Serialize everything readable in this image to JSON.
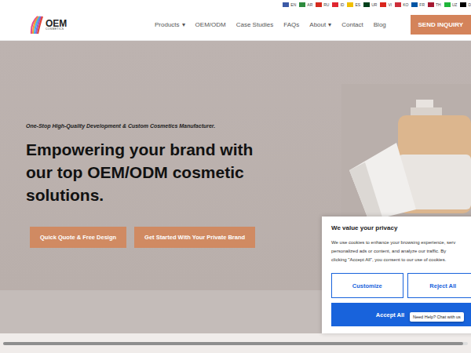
{
  "language_bar": [
    {
      "label": "EN",
      "color": "#3c5aa6"
    },
    {
      "label": "AR",
      "color": "#2e8b3e"
    },
    {
      "label": "RU",
      "color": "#d52b1e"
    },
    {
      "label": "ID",
      "color": "#e0252f"
    },
    {
      "label": "ES",
      "color": "#f1bf00"
    },
    {
      "label": "UR",
      "color": "#01411c"
    },
    {
      "label": "VI",
      "color": "#da251d"
    },
    {
      "label": "KO",
      "color": "#cd2e3a"
    },
    {
      "label": "FR",
      "color": "#0055a4"
    },
    {
      "label": "TH",
      "color": "#a51931"
    },
    {
      "label": "UZ",
      "color": "#1eb53a"
    },
    {
      "label": "D",
      "color": "#000000"
    }
  ],
  "logo": {
    "main": "OEM",
    "sub": "COSMETICS"
  },
  "nav": [
    {
      "label": "Products",
      "caret": "▾"
    },
    {
      "label": "OEM/ODM",
      "caret": ""
    },
    {
      "label": "Case Studies",
      "caret": ""
    },
    {
      "label": "FAQs",
      "caret": ""
    },
    {
      "label": "About",
      "caret": "▾"
    },
    {
      "label": "Contact",
      "caret": ""
    },
    {
      "label": "Blog",
      "caret": ""
    }
  ],
  "inquiry_button": "SEND INQUIRY",
  "hero": {
    "tagline": "One-Stop High-Quality Development & Custom Cosmetics Manufacturer.",
    "headline": "Empowering your brand with our top OEM/ODM cosmetic solutions.",
    "buttons": [
      "Quick Quote & Free Design",
      "Get Started With Your Private Brand"
    ]
  },
  "cookie_dialog": {
    "title": "We value your privacy",
    "lines": [
      "We use cookies to enhance your browsing experience, serv",
      "personalized ads or content, and analyze our traffic. By",
      "clicking \"Accept All\", you consent to our use of cookies."
    ],
    "buttons": [
      "Customize",
      "Reject All"
    ],
    "accept": "Accept All"
  },
  "chat_tooltip": "Need Help? Chat with us"
}
